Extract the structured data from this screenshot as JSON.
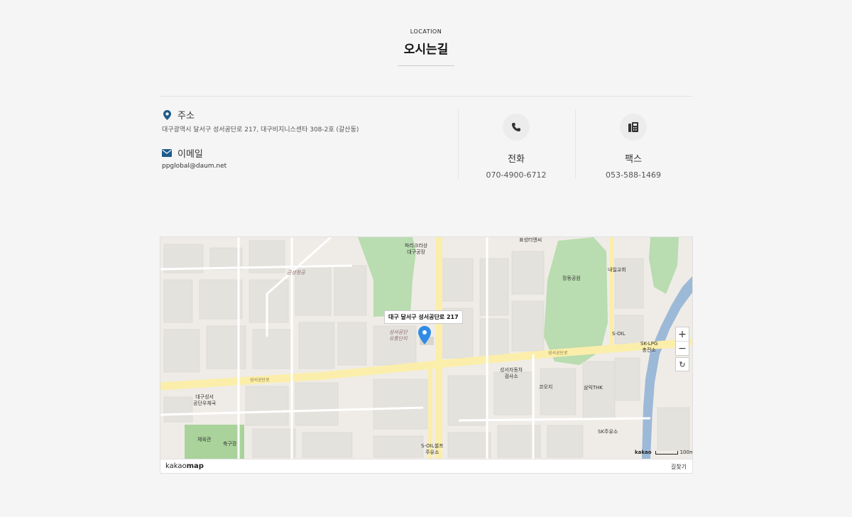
{
  "header": {
    "subtitle": "LOCATION",
    "title": "오시는길"
  },
  "address": {
    "label": "주소",
    "icon": "map-pin-icon",
    "value": "대구광역시 달서구 성서공단로 217, 대구비지니스센타 308-2호 (갈산동)"
  },
  "email": {
    "label": "이메일",
    "icon": "envelope-icon",
    "value": "ppglobal@daum.net"
  },
  "phone": {
    "label": "전화",
    "icon": "phone-icon",
    "value": "070-4900-6712"
  },
  "fax": {
    "label": "팩스",
    "icon": "fax-icon",
    "value": "053-588-1469"
  },
  "map": {
    "callout": "대구 달서구 성서공단로 217",
    "labels": {
      "l1": "파리크라상\n대구공장",
      "l2": "성서공단\n유통단지",
      "l3": "장동공원",
      "l4": "내일교회",
      "l5": "S-OIL",
      "l6": "SK-LPG\n충전소",
      "l7": "성서자동차\n검사소",
      "l8": "코오지",
      "l9": "삼익THK",
      "l10": "대구성서\n공단우체국",
      "l11": "체육관",
      "l12": "축구장",
      "l13": "S-OIL셀프\n주유소",
      "l14": "SK주유소",
      "l15": "성서공단로",
      "l16": "성서공단로",
      "l17": "표성터앤씨",
      "l18": "금성정공"
    },
    "zoom_in": "+",
    "zoom_out": "−",
    "reset": "↻",
    "scale_logo": "kakao",
    "scale_text": "100m",
    "brand_prefix": "kakao",
    "brand_suffix": "map",
    "route": "길찾기",
    "colors": {
      "road": "#fbeeaa",
      "park": "#b9dcb0",
      "water": "#9db9d8",
      "block": "#e4e2dd"
    }
  }
}
